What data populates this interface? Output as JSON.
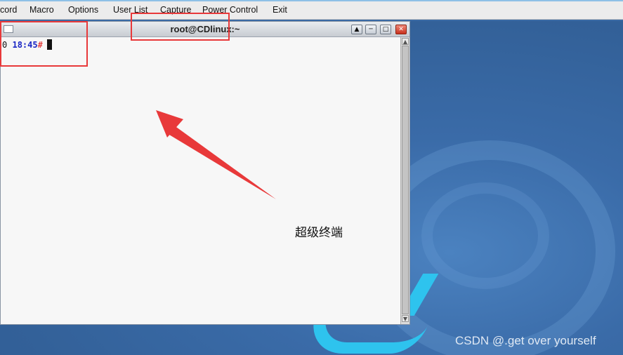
{
  "menubar": {
    "items": [
      "cord",
      "Macro",
      "Options",
      "User List",
      "Capture",
      "Power Control",
      "Exit"
    ]
  },
  "window": {
    "title": "root@CDlinux:~",
    "prompt_prefix": "0",
    "prompt_time": "18:45",
    "prompt_symbol": "#",
    "buttons": {
      "up": "up-icon",
      "minimize": "minimize-icon",
      "maximize": "maximize-icon",
      "close": "close-icon"
    }
  },
  "annotation": {
    "label": "超级终端",
    "color": "#e8393a"
  },
  "watermark": "CSDN @.get over yourself"
}
